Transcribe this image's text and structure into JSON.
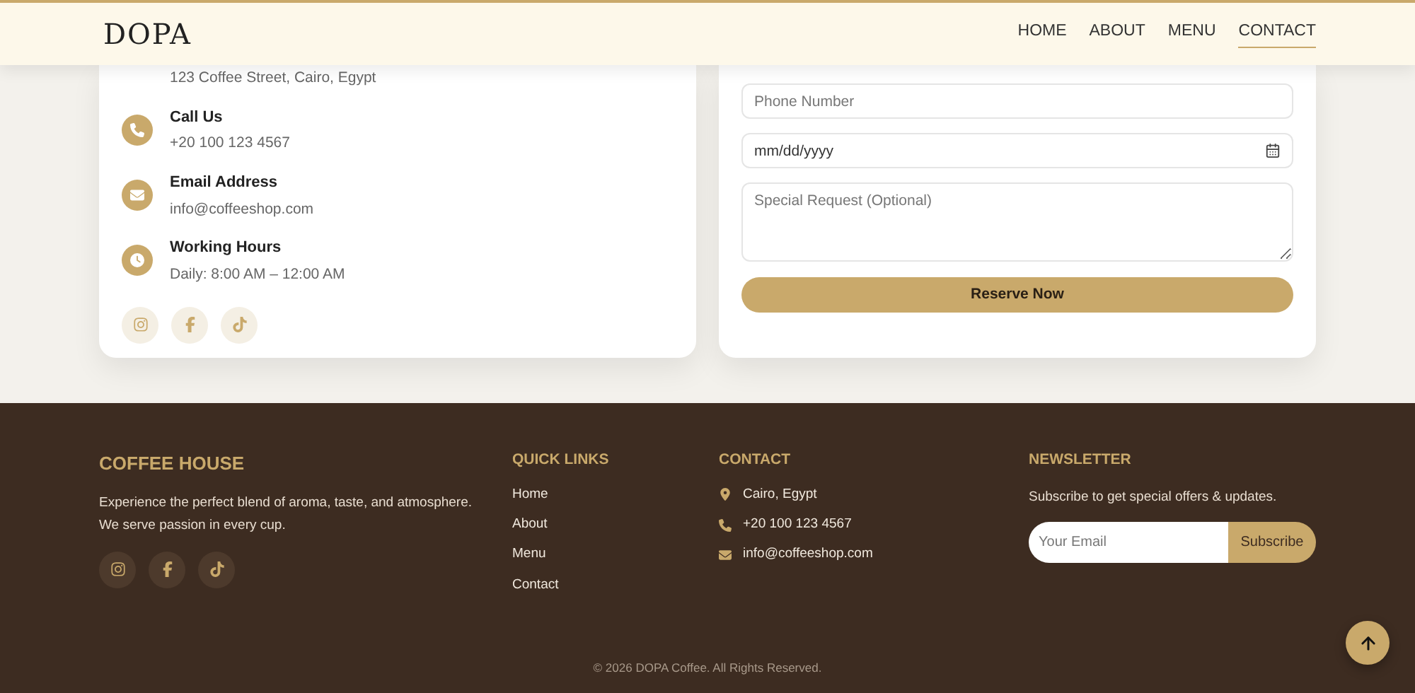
{
  "header": {
    "logo": "DOPA",
    "nav": [
      {
        "label": "HOME",
        "selected": false
      },
      {
        "label": "ABOUT",
        "selected": false
      },
      {
        "label": "MENU",
        "selected": false
      },
      {
        "label": "CONTACT",
        "selected": true
      }
    ]
  },
  "contact_card": {
    "address": "123 Coffee Street, Cairo, Egypt",
    "items": [
      {
        "kind": "phone",
        "title": "Call Us",
        "value": "+20 100 123 4567"
      },
      {
        "kind": "email",
        "title": "Email Address",
        "value": "info@coffeeshop.com"
      },
      {
        "kind": "hours",
        "title": "Working Hours",
        "value": "Daily: 8:00 AM – 12:00 AM"
      }
    ]
  },
  "reservation_form": {
    "phone": {
      "placeholder": "Phone Number"
    },
    "date": {
      "placeholder": "mm/dd/yyyy"
    },
    "request": {
      "placeholder": "Special Request (Optional)"
    },
    "submit": "Reserve Now"
  },
  "footer": {
    "brand": {
      "title": "COFFEE HOUSE",
      "text": "Experience the perfect blend of aroma, taste, and atmosphere. We serve passion in every cup."
    },
    "quick_links": {
      "title": "QUICK LINKS",
      "links": [
        "Home",
        "About",
        "Menu",
        "Contact"
      ]
    },
    "contact": {
      "title": "CONTACT",
      "items": [
        {
          "kind": "location",
          "text": "Cairo, Egypt"
        },
        {
          "kind": "phone",
          "text": "+20 100 123 4567"
        },
        {
          "kind": "email",
          "text": "info@coffeeshop.com"
        }
      ]
    },
    "newsletter": {
      "title": "NEWSLETTER",
      "text": "Subscribe to get special offers & updates.",
      "email": {
        "placeholder": "Your Email"
      },
      "button": "Subscribe"
    },
    "copyright": "© 2026 DOPA Coffee. All Rights Reserved."
  }
}
